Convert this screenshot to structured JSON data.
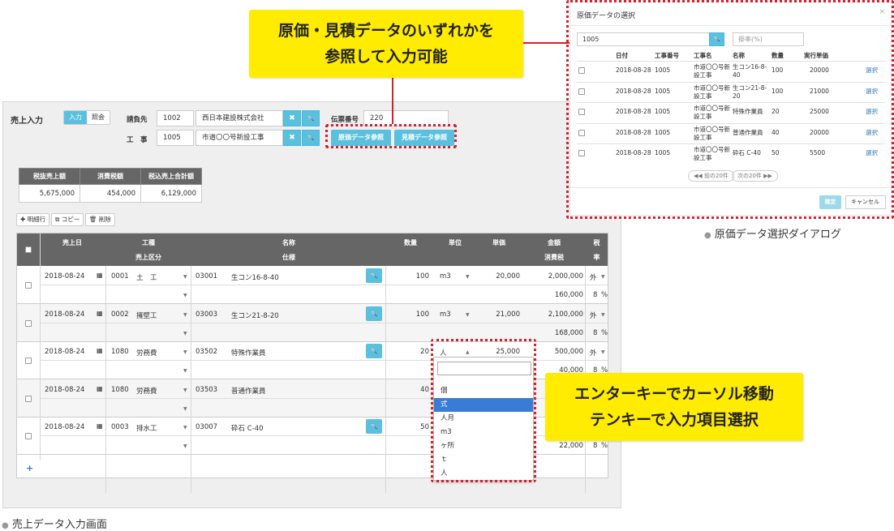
{
  "callouts": {
    "top": {
      "line1": "原価・見積データのいずれかを",
      "line2": "参照して入力可能"
    },
    "bottom": {
      "line1": "エンターキーでカーソル移動",
      "line2": "テンキーで入力項目選択"
    }
  },
  "captions": {
    "main": "売上データ入力画面",
    "dialog": "原価データ選択ダイアログ"
  },
  "form": {
    "title": "売上入力",
    "mode_input": "入力",
    "mode_view": "照会",
    "billing_label": "請負先",
    "billing_code": "1002",
    "billing_name": "西日本建設株式会社",
    "construction_label": "工　事",
    "construction_code": "1005",
    "construction_name": "市道〇〇号新設工事",
    "slip_label": "伝票番号",
    "slip_no": "220",
    "cost_ref_button": "原価データ参照",
    "estimate_ref_button": "見積データ参照",
    "clear_glyph": "✖",
    "search_glyph": "🔍"
  },
  "summary": {
    "headers": [
      "税抜売上額",
      "消費税額",
      "税込売上合計額"
    ],
    "values": [
      "5,675,000",
      "454,000",
      "6,129,000"
    ]
  },
  "toolbar": {
    "add": "✚ 明細行",
    "copy": "⧉ コピー",
    "delete": "🗑 削除"
  },
  "grid": {
    "headers": {
      "date": "売上日",
      "kind": "工種",
      "kind_sub": "売上区分",
      "name": "名称",
      "name_sub": "仕様",
      "qty": "数量",
      "unit": "単位",
      "price": "単価",
      "amount": "金額",
      "amount_sub": "消費税",
      "tax": "税",
      "tax_sub": "率"
    },
    "rows": [
      {
        "date": "2018-08-24",
        "kind_code": "0001",
        "kind_name": "土　工",
        "code": "03001",
        "name": "生コン16-8-40",
        "qty": "100",
        "unit": "m3",
        "price": "20,000",
        "amount": "2,000,000",
        "tax_type": "外",
        "tax": "160,000",
        "rate": "8",
        "pct": "%"
      },
      {
        "date": "2018-08-24",
        "kind_code": "0002",
        "kind_name": "擁壁工",
        "code": "03003",
        "name": "生コン21-8-20",
        "qty": "100",
        "unit": "m3",
        "price": "21,000",
        "amount": "2,100,000",
        "tax_type": "外",
        "tax": "168,000",
        "rate": "8",
        "pct": "%"
      },
      {
        "date": "2018-08-24",
        "kind_code": "1080",
        "kind_name": "労務費",
        "code": "03502",
        "name": "特殊作業員",
        "qty": "20",
        "unit": "人",
        "price": "25,000",
        "amount": "500,000",
        "tax_type": "外",
        "tax": "40,000",
        "rate": "8",
        "pct": "%"
      },
      {
        "date": "2018-08-24",
        "kind_code": "1080",
        "kind_name": "労務費",
        "code": "03503",
        "name": "普通作業員",
        "qty": "40",
        "unit": "",
        "price": "",
        "amount": "",
        "tax_type": "",
        "tax": "",
        "rate": "",
        "pct": ""
      },
      {
        "date": "2018-08-24",
        "kind_code": "0003",
        "kind_name": "排水工",
        "code": "03007",
        "name": "砕石 C-40",
        "qty": "50",
        "unit": "",
        "price": "",
        "amount": "",
        "tax_type": "",
        "tax": "22,000",
        "rate": "8",
        "pct": "%"
      }
    ],
    "add_row": "+"
  },
  "dropdown": {
    "options": [
      "個",
      "式",
      "人月",
      "m3",
      "ヶ所",
      "ｔ",
      "人"
    ],
    "selected": 1
  },
  "dialog": {
    "title": "原価データの選択",
    "close": "×",
    "search_value": "1005",
    "rate_placeholder": "掛率(%)",
    "headers": [
      "日付",
      "工事番号",
      "工事名",
      "名称",
      "数量",
      "実行単価"
    ],
    "rows": [
      {
        "date": "2018-08-28",
        "no": "1005",
        "kname1": "市道〇〇号新",
        "kname2": "設工事",
        "name1": "生コン16-8-",
        "name2": "40",
        "qty": "100",
        "price": "20000",
        "link": "選択"
      },
      {
        "date": "2018-08-28",
        "no": "1005",
        "kname1": "市道〇〇号新",
        "kname2": "設工事",
        "name1": "生コン21-8-",
        "name2": "20",
        "qty": "100",
        "price": "21000",
        "link": "選択"
      },
      {
        "date": "2018-08-28",
        "no": "1005",
        "kname1": "市道〇〇号新",
        "kname2": "設工事",
        "name1": "特殊作業員",
        "name2": "",
        "qty": "20",
        "price": "25000",
        "link": "選択"
      },
      {
        "date": "2018-08-28",
        "no": "1005",
        "kname1": "市道〇〇号新",
        "kname2": "設工事",
        "name1": "普通作業員",
        "name2": "",
        "qty": "40",
        "price": "20000",
        "link": "選択"
      },
      {
        "date": "2018-08-28",
        "no": "1005",
        "kname1": "市道〇〇号新",
        "kname2": "設工事",
        "name1": "砕石 C-40",
        "name2": "",
        "qty": "50",
        "price": "5500",
        "link": "選択"
      }
    ],
    "prev": "◀◀ 前の20件",
    "next": "次の20件 ▶▶",
    "ok": "確定",
    "cancel": "キャンセル"
  }
}
